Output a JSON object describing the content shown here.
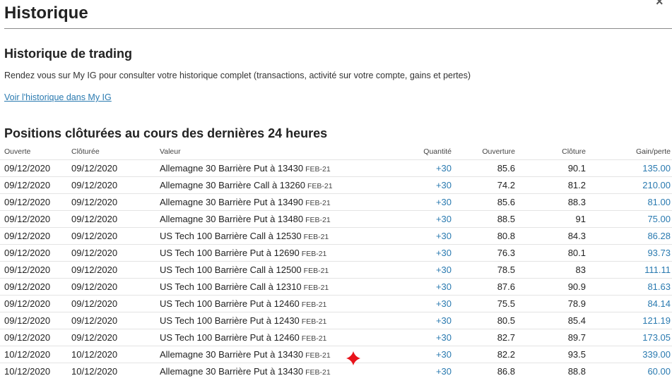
{
  "header": {
    "title": "Historique",
    "close_label": "×"
  },
  "trading_history": {
    "title": "Historique de trading",
    "description": "Rendez vous sur My IG pour consulter votre historique complet (transactions, activité sur votre compte, gains et pertes)",
    "link": "Voir l'historique dans My IG"
  },
  "positions": {
    "title": "Positions clôturées au cours des dernières 24 heures",
    "columns": {
      "opened": "Ouverte",
      "closed": "Clôturée",
      "value": "Valeur",
      "quantity": "Quantité",
      "open_price": "Ouverture",
      "close_price": "Clôture",
      "pl": "Gain/perte"
    },
    "rows": [
      {
        "opened": "09/12/2020",
        "closed": "09/12/2020",
        "market": "Allemagne 30 Barrière Put à 13430",
        "expiry": "FEB-21",
        "quantity": "+30",
        "open_price": "85.6",
        "close_price": "90.1",
        "pl": "135.00"
      },
      {
        "opened": "09/12/2020",
        "closed": "09/12/2020",
        "market": "Allemagne 30 Barrière Call à 13260",
        "expiry": "FEB-21",
        "quantity": "+30",
        "open_price": "74.2",
        "close_price": "81.2",
        "pl": "210.00"
      },
      {
        "opened": "09/12/2020",
        "closed": "09/12/2020",
        "market": "Allemagne 30 Barrière Put à 13490",
        "expiry": "FEB-21",
        "quantity": "+30",
        "open_price": "85.6",
        "close_price": "88.3",
        "pl": "81.00"
      },
      {
        "opened": "09/12/2020",
        "closed": "09/12/2020",
        "market": "Allemagne 30 Barrière Put à 13480",
        "expiry": "FEB-21",
        "quantity": "+30",
        "open_price": "88.5",
        "close_price": "91",
        "pl": "75.00"
      },
      {
        "opened": "09/12/2020",
        "closed": "09/12/2020",
        "market": "US Tech 100 Barrière Call à 12530",
        "expiry": "FEB-21",
        "quantity": "+30",
        "open_price": "80.8",
        "close_price": "84.3",
        "pl": "86.28"
      },
      {
        "opened": "09/12/2020",
        "closed": "09/12/2020",
        "market": "US Tech 100 Barrière Put à 12690",
        "expiry": "FEB-21",
        "quantity": "+30",
        "open_price": "76.3",
        "close_price": "80.1",
        "pl": "93.73"
      },
      {
        "opened": "09/12/2020",
        "closed": "09/12/2020",
        "market": "US Tech 100 Barrière Call à 12500",
        "expiry": "FEB-21",
        "quantity": "+30",
        "open_price": "78.5",
        "close_price": "83",
        "pl": "111.11"
      },
      {
        "opened": "09/12/2020",
        "closed": "09/12/2020",
        "market": "US Tech 100 Barrière Call à 12310",
        "expiry": "FEB-21",
        "quantity": "+30",
        "open_price": "87.6",
        "close_price": "90.9",
        "pl": "81.63"
      },
      {
        "opened": "09/12/2020",
        "closed": "09/12/2020",
        "market": "US Tech 100 Barrière Put à 12460",
        "expiry": "FEB-21",
        "quantity": "+30",
        "open_price": "75.5",
        "close_price": "78.9",
        "pl": "84.14"
      },
      {
        "opened": "09/12/2020",
        "closed": "09/12/2020",
        "market": "US Tech 100 Barrière Put à 12430",
        "expiry": "FEB-21",
        "quantity": "+30",
        "open_price": "80.5",
        "close_price": "85.4",
        "pl": "121.19"
      },
      {
        "opened": "09/12/2020",
        "closed": "09/12/2020",
        "market": "US Tech 100 Barrière Put à 12460",
        "expiry": "FEB-21",
        "quantity": "+30",
        "open_price": "82.7",
        "close_price": "89.7",
        "pl": "173.05"
      },
      {
        "opened": "10/12/2020",
        "closed": "10/12/2020",
        "market": "Allemagne 30 Barrière Put à 13430",
        "expiry": "FEB-21",
        "quantity": "+30",
        "open_price": "82.2",
        "close_price": "93.5",
        "pl": "339.00"
      },
      {
        "opened": "10/12/2020",
        "closed": "10/12/2020",
        "market": "Allemagne 30 Barrière Put à 13430",
        "expiry": "FEB-21",
        "quantity": "+30",
        "open_price": "86.8",
        "close_price": "88.8",
        "pl": "60.00"
      }
    ]
  },
  "colors": {
    "link": "#2a7ab0",
    "text": "#222222",
    "divider": "#8a8a8a",
    "marker": "#e8131b"
  },
  "marker": {
    "icon": "red-cross-marker-icon"
  }
}
